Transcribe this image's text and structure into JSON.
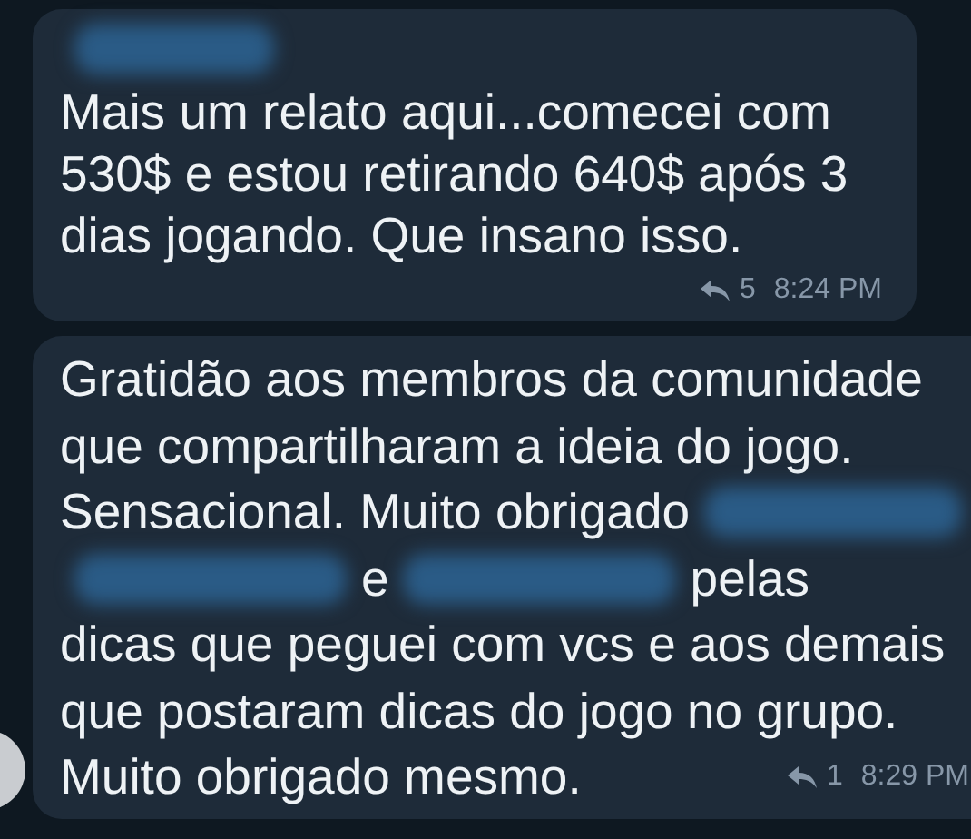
{
  "messages": [
    {
      "sender": {
        "kind": "redacted"
      },
      "lines": [
        {
          "parts": [
            {
              "kind": "text",
              "text": "Mais um relato aqui...comecei com"
            }
          ]
        },
        {
          "parts": [
            {
              "kind": "text",
              "text": "530$ e estou retirando 640$ após 3"
            }
          ]
        },
        {
          "parts": [
            {
              "kind": "text",
              "text": "dias jogando. Que insano isso."
            }
          ]
        }
      ],
      "replies": "5",
      "time": "8:24 PM"
    },
    {
      "lines": [
        {
          "parts": [
            {
              "kind": "text",
              "text": "Gratidão aos membros da comunidade"
            }
          ]
        },
        {
          "parts": [
            {
              "kind": "text",
              "text": "que compartilharam a ideia do jogo."
            }
          ]
        },
        {
          "parts": [
            {
              "kind": "text",
              "text": "Sensacional. Muito obrigado"
            },
            {
              "kind": "redacted"
            }
          ]
        },
        {
          "parts": [
            {
              "kind": "redacted"
            },
            {
              "kind": "text",
              "text": "e"
            },
            {
              "kind": "redacted"
            },
            {
              "kind": "text",
              "text": "pelas"
            }
          ]
        },
        {
          "parts": [
            {
              "kind": "text",
              "text": "dicas que peguei com vcs e aos demais"
            }
          ]
        },
        {
          "parts": [
            {
              "kind": "text",
              "text": "que postaram dicas do jogo no grupo."
            }
          ]
        },
        {
          "parts": [
            {
              "kind": "text",
              "text": "Muito obrigado mesmo."
            }
          ]
        }
      ],
      "replies": "1",
      "time": "8:29 PM"
    }
  ]
}
